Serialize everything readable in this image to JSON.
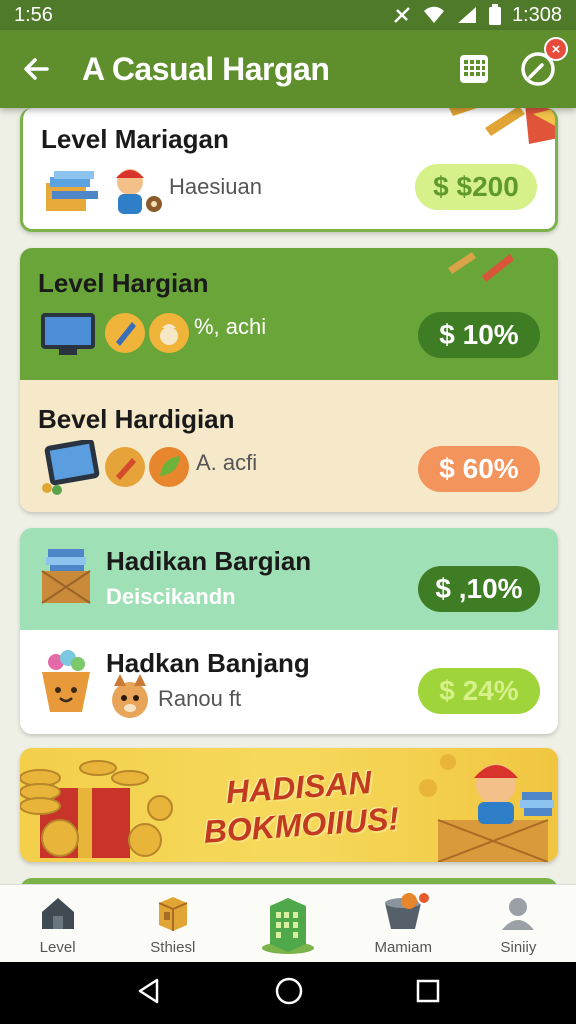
{
  "status_bar": {
    "time": "1:56",
    "time_right": "1:308",
    "icons": [
      "signal-off-icon",
      "wifi-icon",
      "cellular-icon",
      "battery-icon"
    ]
  },
  "app_bar": {
    "title": "A Casual Hargan",
    "icons": [
      "back-arrow-icon",
      "calendar-icon",
      "compass-icon"
    ],
    "badge": "×"
  },
  "cards": [
    {
      "title": "Level Mariagan",
      "subtitle": "Haesiuan",
      "value": "$ $200",
      "pill_color": "#d6f08a"
    },
    {
      "title": "Level Hargian",
      "subtitle": "%, achi",
      "value": "$ 10%",
      "pill_color": "#3f7d24"
    },
    {
      "title": "Bevel Hardigian",
      "subtitle": "A. acfi",
      "value": "$ 60%",
      "pill_color": "#f2945c"
    },
    {
      "title": "Hadikan Bargian",
      "subtitle": "Deiscikandn",
      "value": "$ ,10%",
      "pill_color": "#3f7d24"
    },
    {
      "title": "Hadkan Banjang",
      "subtitle": "Ranou ft",
      "value": "$ 24%",
      "pill_color": "#9fd43a"
    }
  ],
  "banner": {
    "line1": "HADISAN",
    "line2": "BOKMOIIUS!"
  },
  "bottom_nav": [
    {
      "label": "Level",
      "icon": "home-icon"
    },
    {
      "label": "Sthiesl",
      "icon": "crate-icon"
    },
    {
      "label": "",
      "icon": "building-icon"
    },
    {
      "label": "Mamiam",
      "icon": "basket-icon"
    },
    {
      "label": "Siniiy",
      "icon": "profile-icon"
    }
  ],
  "system_nav": [
    "back-triangle-icon",
    "home-circle-icon",
    "recents-square-icon"
  ]
}
